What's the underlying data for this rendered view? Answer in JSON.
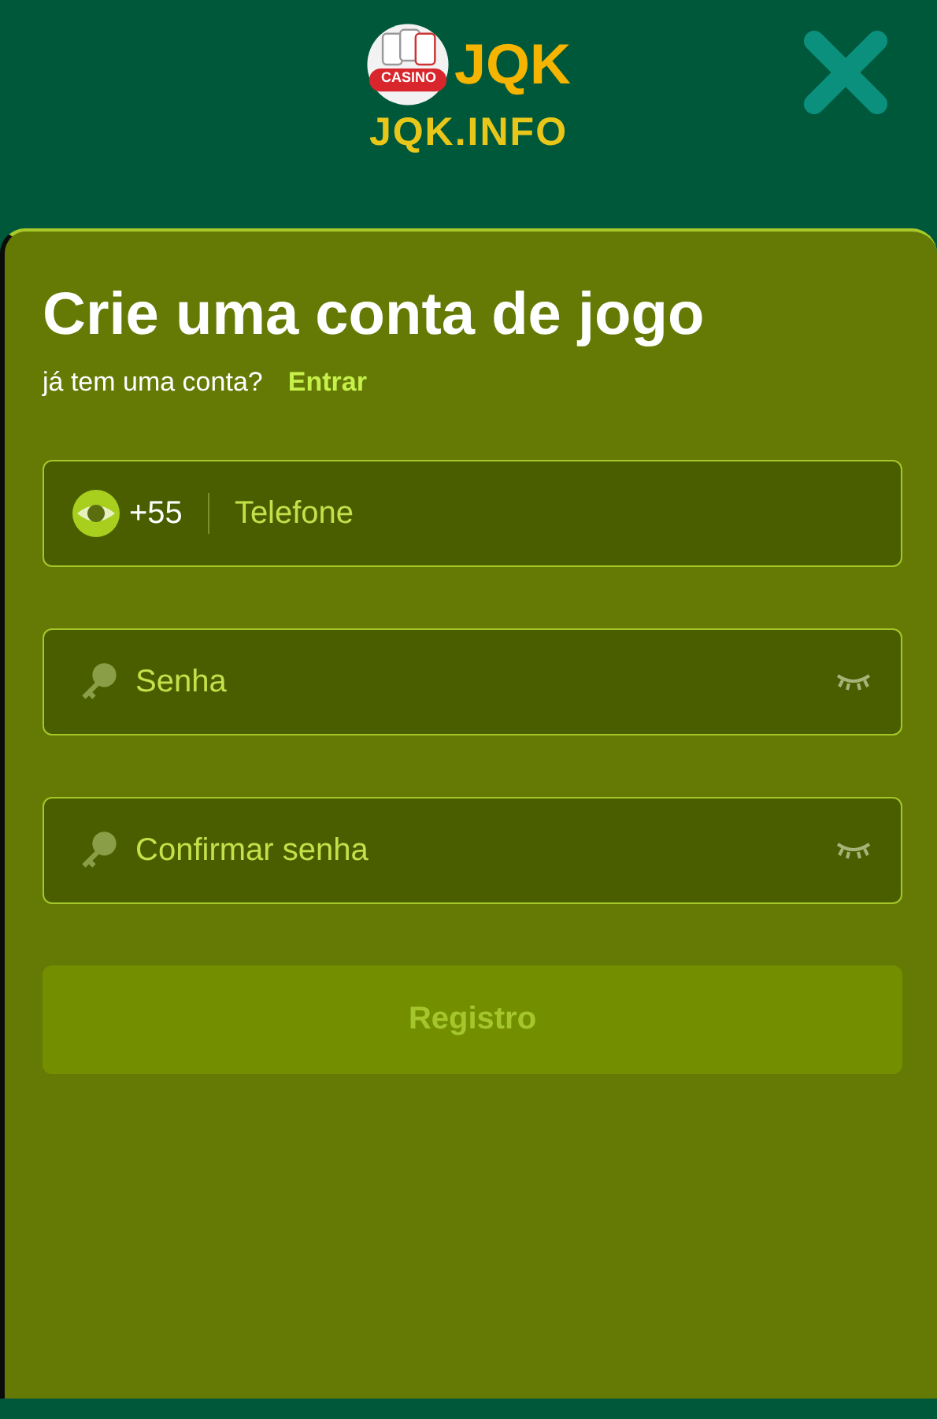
{
  "header": {
    "logo": {
      "badge": "CASINO",
      "brand": "JQK",
      "domain": "JQK.INFO"
    }
  },
  "form": {
    "title": "Crie uma conta de jogo",
    "prompt": "já tem uma conta?",
    "login_link": "Entrar",
    "fields": [
      {
        "kind": "phone",
        "prefix": "+55",
        "placeholder": "Telefone"
      },
      {
        "kind": "password",
        "placeholder": "Senha"
      },
      {
        "kind": "password",
        "placeholder": "Confirmar senha"
      }
    ],
    "submit": {
      "label": "Registro",
      "disabled": true
    }
  }
}
